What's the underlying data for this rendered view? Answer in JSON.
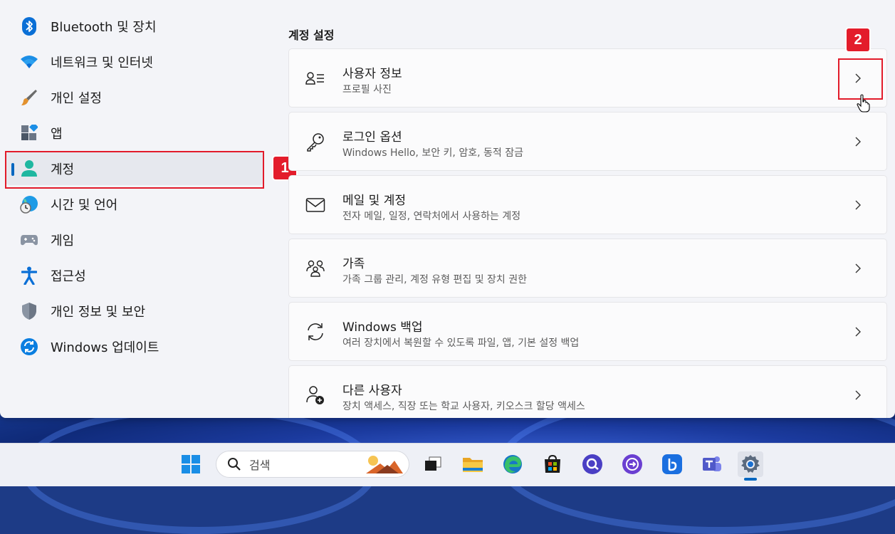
{
  "sidebar": {
    "items": [
      {
        "label": "Bluetooth 및 장치",
        "icon": "bluetooth-icon"
      },
      {
        "label": "네트워크 및 인터넷",
        "icon": "wifi-icon"
      },
      {
        "label": "개인 설정",
        "icon": "paintbrush-icon"
      },
      {
        "label": "앱",
        "icon": "apps-icon"
      },
      {
        "label": "계정",
        "icon": "account-icon",
        "selected": true
      },
      {
        "label": "시간 및 언어",
        "icon": "globe-clock-icon"
      },
      {
        "label": "게임",
        "icon": "gamepad-icon"
      },
      {
        "label": "접근성",
        "icon": "accessibility-icon"
      },
      {
        "label": "개인 정보 및 보안",
        "icon": "shield-icon"
      },
      {
        "label": "Windows 업데이트",
        "icon": "update-icon"
      }
    ]
  },
  "main": {
    "section_title": "계정 설정",
    "cards": [
      {
        "title": "사용자 정보",
        "subtitle": "프로필 사진",
        "icon": "user-info-icon"
      },
      {
        "title": "로그인 옵션",
        "subtitle": "Windows Hello, 보안 키, 암호, 동적 잠금",
        "icon": "key-icon"
      },
      {
        "title": "메일 및 계정",
        "subtitle": "전자 메일, 일정, 연락처에서 사용하는 계정",
        "icon": "mail-icon"
      },
      {
        "title": "가족",
        "subtitle": "가족 그룹 관리, 계정 유형 편집 및 장치 권한",
        "icon": "family-icon"
      },
      {
        "title": "Windows 백업",
        "subtitle": "여러 장치에서 복원할 수 있도록 파일, 앱, 기본 설정 백업",
        "icon": "backup-sync-icon"
      },
      {
        "title": "다른 사용자",
        "subtitle": "장치 액세스, 직장 또는 학교 사용자, 키오스크 할당 액세스",
        "icon": "add-user-icon"
      }
    ]
  },
  "callouts": {
    "one": "1",
    "two": "2"
  },
  "taskbar": {
    "search_text": "검색",
    "icons": [
      "windows-start-icon",
      "task-view-icon",
      "file-explorer-icon",
      "edge-icon",
      "store-icon",
      "app-search-icon",
      "app-arrow-icon",
      "bing-icon",
      "teams-icon",
      "settings-gear-icon"
    ]
  },
  "colors": {
    "accent": "#0067c0",
    "callout_red": "#e31c2b",
    "window_bg": "#f3f4f8",
    "card_bg": "#fbfbfc"
  }
}
